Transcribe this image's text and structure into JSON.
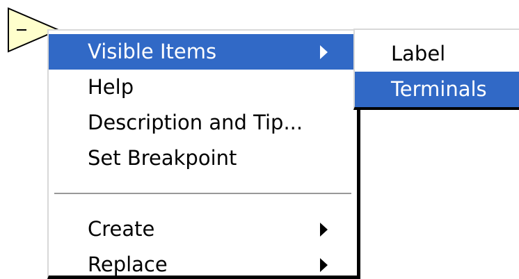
{
  "node": {
    "icon": "subtract-function-triangle-icon",
    "fill_color": "#ffffcc",
    "symbol": "−"
  },
  "context_menu": {
    "items": [
      {
        "label": "Visible Items",
        "has_submenu": true,
        "highlighted": true
      },
      {
        "label": "Help",
        "has_submenu": false
      },
      {
        "label": "Description and Tip...",
        "has_submenu": false
      },
      {
        "label": "Set Breakpoint",
        "has_submenu": false
      },
      {
        "label": "Create",
        "has_submenu": true
      },
      {
        "label": "Replace",
        "has_submenu": true
      }
    ],
    "highlight_color": "#3169c6"
  },
  "submenu": {
    "items": [
      {
        "label": "Label",
        "highlighted": false
      },
      {
        "label": "Terminals",
        "highlighted": true
      }
    ]
  }
}
